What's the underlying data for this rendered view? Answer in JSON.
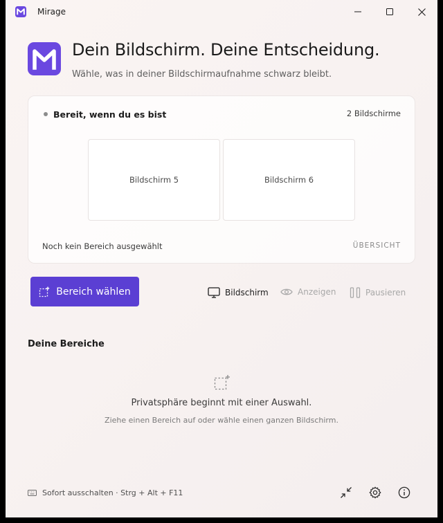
{
  "window": {
    "title": "Mirage"
  },
  "icons": {
    "app": "mirage-logo-icon",
    "minimize": "minimize-icon",
    "maximize": "maximize-icon",
    "close": "close-icon",
    "select_area": "dashed-selection-icon",
    "monitor": "monitor-icon",
    "eye": "eye-icon",
    "pause": "pause-icon",
    "keyboard": "keyboard-icon",
    "collapse": "collapse-arrows-icon",
    "settings": "gear-icon",
    "info": "info-icon"
  },
  "colors": {
    "accent": "#5b3fd3"
  },
  "header": {
    "title": "Dein Bildschirm. Deine Entscheidung.",
    "subtitle": "Wähle, was in deiner Bildschirmaufnahme schwarz bleibt."
  },
  "status_card": {
    "status": "Bereit, wenn du es bist",
    "screen_count": "2 Bildschirme",
    "screens": [
      {
        "label": "Bildschirm 5"
      },
      {
        "label": "Bildschirm 6"
      }
    ],
    "selection_hint": "Noch kein Bereich ausgewählt",
    "overview_label": "ÜBERSICHT"
  },
  "actions": {
    "select_area_label": "Bereich wählen",
    "mode_screen": "Bildschirm",
    "mode_show": "Anzeigen",
    "mode_pause": "Pausieren"
  },
  "areas": {
    "title": "Deine Bereiche",
    "empty_title": "Privatsphäre beginnt mit einer Auswahl.",
    "empty_subtitle": "Ziehe einen Bereich auf oder wähle einen ganzen Bildschirm."
  },
  "footer": {
    "shortcut": "Sofort ausschalten · Strg + Alt + F11"
  }
}
